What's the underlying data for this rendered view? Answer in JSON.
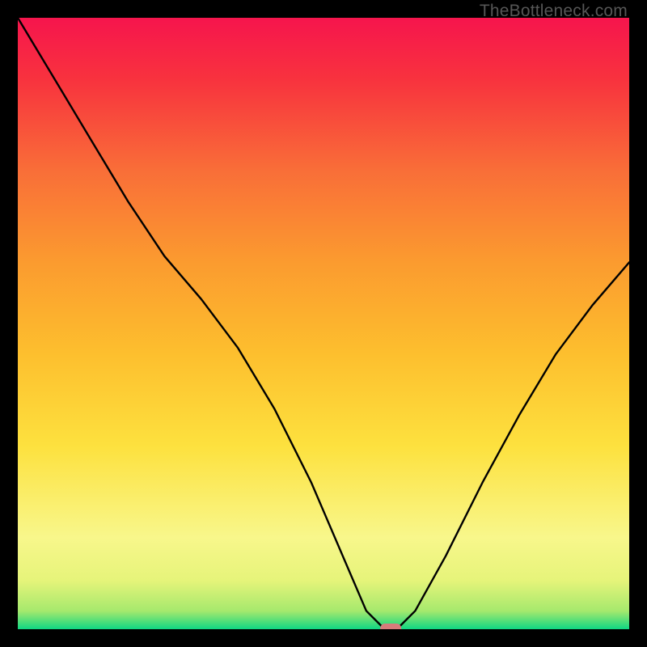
{
  "watermark": "TheBottleneck.com",
  "chart_data": {
    "type": "line",
    "title": "",
    "xlabel": "",
    "ylabel": "",
    "xlim": [
      0,
      100
    ],
    "ylim": [
      0,
      100
    ],
    "series": [
      {
        "name": "bottleneck-curve",
        "x": [
          0,
          6,
          12,
          18,
          24,
          30,
          36,
          42,
          48,
          54,
          57,
          60,
          62,
          65,
          70,
          76,
          82,
          88,
          94,
          100
        ],
        "y": [
          100,
          90,
          80,
          70,
          61,
          54,
          46,
          36,
          24,
          10,
          3,
          0,
          0,
          3,
          12,
          24,
          35,
          45,
          53,
          60
        ]
      }
    ],
    "marker": {
      "x": 61,
      "y": 0,
      "color": "#d77b7b"
    },
    "bands": {
      "note": "horizontal color bands from bottom (y=0) to top (y=100), qualitative",
      "stops": [
        {
          "y": 0,
          "color": "#0fd683"
        },
        {
          "y": 3,
          "color": "#a6e96d"
        },
        {
          "y": 8,
          "color": "#e6f47a"
        },
        {
          "y": 15,
          "color": "#f8f78b"
        },
        {
          "y": 30,
          "color": "#fde13e"
        },
        {
          "y": 45,
          "color": "#fdbf2e"
        },
        {
          "y": 60,
          "color": "#fb9b2f"
        },
        {
          "y": 75,
          "color": "#f96e38"
        },
        {
          "y": 90,
          "color": "#f8323e"
        },
        {
          "y": 100,
          "color": "#f6154d"
        }
      ]
    }
  }
}
